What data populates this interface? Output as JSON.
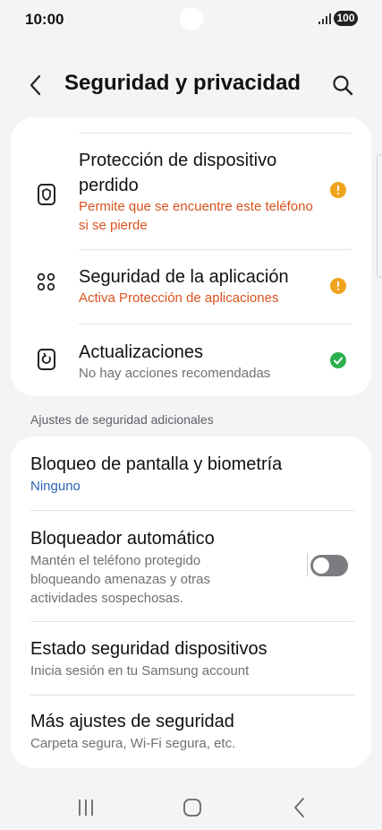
{
  "status_bar": {
    "time": "10:00",
    "battery": "100"
  },
  "header": {
    "title": "Seguridad y privacidad"
  },
  "top_card": {
    "items": [
      {
        "title": "Protección de dispositivo perdido",
        "title_line1": "Protección de dispositivo",
        "title_line2": "perdido",
        "subtitle_line1": "Permite que se encuentre este teléfono",
        "subtitle_line2": "si se pierde",
        "status": "warning"
      },
      {
        "title": "Seguridad de la aplicación",
        "subtitle": "Activa Protección de aplicaciones",
        "status": "warning"
      },
      {
        "title": "Actualizaciones",
        "subtitle": "No hay acciones recomendadas",
        "status": "ok"
      }
    ]
  },
  "section_label": "Ajustes de seguridad adicionales",
  "bottom_card": {
    "items": [
      {
        "title": "Bloqueo de pantalla y biometría",
        "subtitle": "Ninguno"
      },
      {
        "title": "Bloqueador automático",
        "subtitle_line1": "Mantén el teléfono protegido",
        "subtitle_line2": "bloqueando amenazas y otras",
        "subtitle_line3": "actividades sospechosas.",
        "toggle_on": false
      },
      {
        "title": "Estado seguridad dispositivos",
        "subtitle": "Inicia sesión en tu Samsung account"
      },
      {
        "title": "Más ajustes de seguridad",
        "subtitle": "Carpeta segura, Wi-Fi segura, etc."
      }
    ]
  },
  "colors": {
    "warning": "#f0a41d",
    "ok": "#2bb04e",
    "subtitle_orange": "#d9531e",
    "link_blue": "#2a64b3"
  }
}
